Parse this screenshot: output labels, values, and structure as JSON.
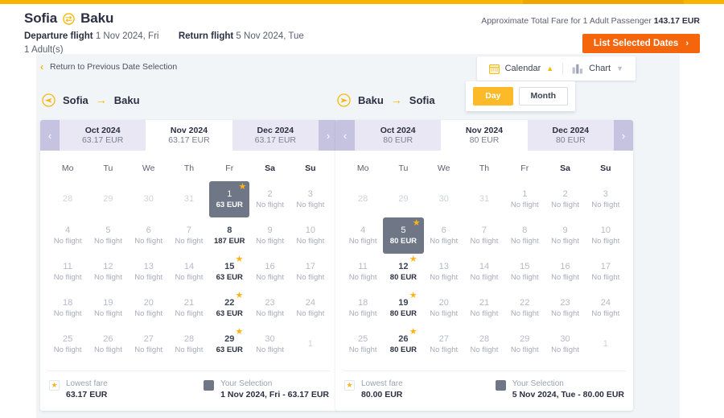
{
  "header": {
    "origin": "Sofia",
    "destination": "Baku",
    "roundtrip_icon": "roundtrip-arrows-icon",
    "departure_label": "Departure flight",
    "departure_value": "1 Nov 2024, Fri",
    "return_label": "Return flight",
    "return_value": "5 Nov 2024, Tue",
    "passengers": "1 Adult(s)",
    "fare_note": "Approximate Total Fare for 1 Adult Passenger",
    "fare_total": "143.17 EUR",
    "list_button": "List Selected Dates",
    "list_button_chevron": "›",
    "accent_yellow": "#f7b500",
    "accent_orange": "#f4650c"
  },
  "toolbar": {
    "return_link": "Return to Previous Date Selection",
    "return_link_icon": "chevron-left-icon",
    "calendar_label": "Calendar",
    "calendar_icon": "calendar-icon",
    "calendar_caret": "▲",
    "chart_label": "Chart",
    "chart_icon": "bar-chart-icon",
    "chart_caret": "▼",
    "day_label": "Day",
    "month_label": "Month",
    "active_granularity": "Day"
  },
  "legs": [
    {
      "id": "outbound",
      "icon": "plane-right-circle-icon",
      "origin": "Sofia",
      "destination": "Baku",
      "arrow": "→",
      "prev_icon": "‹",
      "next_icon": "›",
      "months": [
        {
          "name": "Oct 2024",
          "fare": "63.17 EUR",
          "active": false
        },
        {
          "name": "Nov 2024",
          "fare": "63.17 EUR",
          "active": true
        },
        {
          "name": "Dec 2024",
          "fare": "63.17 EUR",
          "active": false
        }
      ],
      "weekdays": [
        "Mo",
        "Tu",
        "We",
        "Th",
        "Fr",
        "Sa",
        "Su"
      ],
      "weekend_indexes": [
        5,
        6
      ],
      "weeks": [
        [
          {
            "day": "28",
            "sub": "",
            "state": "out"
          },
          {
            "day": "29",
            "sub": "",
            "state": "out"
          },
          {
            "day": "30",
            "sub": "",
            "state": "out"
          },
          {
            "day": "31",
            "sub": "",
            "state": "out"
          },
          {
            "day": "1",
            "sub": "63 EUR",
            "state": "selected",
            "star": true
          },
          {
            "day": "2",
            "sub": "No flight",
            "state": "none"
          },
          {
            "day": "3",
            "sub": "No flight",
            "state": "none"
          }
        ],
        [
          {
            "day": "4",
            "sub": "No flight",
            "state": "none"
          },
          {
            "day": "5",
            "sub": "No flight",
            "state": "none"
          },
          {
            "day": "6",
            "sub": "No flight",
            "state": "none"
          },
          {
            "day": "7",
            "sub": "No flight",
            "state": "none"
          },
          {
            "day": "8",
            "sub": "187 EUR",
            "state": "fare"
          },
          {
            "day": "9",
            "sub": "No flight",
            "state": "none"
          },
          {
            "day": "10",
            "sub": "No flight",
            "state": "none"
          }
        ],
        [
          {
            "day": "11",
            "sub": "No flight",
            "state": "none"
          },
          {
            "day": "12",
            "sub": "No flight",
            "state": "none"
          },
          {
            "day": "13",
            "sub": "No flight",
            "state": "none"
          },
          {
            "day": "14",
            "sub": "No flight",
            "state": "none"
          },
          {
            "day": "15",
            "sub": "63 EUR",
            "state": "fare",
            "star": true
          },
          {
            "day": "16",
            "sub": "No flight",
            "state": "none"
          },
          {
            "day": "17",
            "sub": "No flight",
            "state": "none"
          }
        ],
        [
          {
            "day": "18",
            "sub": "No flight",
            "state": "none"
          },
          {
            "day": "19",
            "sub": "No flight",
            "state": "none"
          },
          {
            "day": "20",
            "sub": "No flight",
            "state": "none"
          },
          {
            "day": "21",
            "sub": "No flight",
            "state": "none"
          },
          {
            "day": "22",
            "sub": "63 EUR",
            "state": "fare",
            "star": true
          },
          {
            "day": "23",
            "sub": "No flight",
            "state": "none"
          },
          {
            "day": "24",
            "sub": "No flight",
            "state": "none"
          }
        ],
        [
          {
            "day": "25",
            "sub": "No flight",
            "state": "none"
          },
          {
            "day": "26",
            "sub": "No flight",
            "state": "none"
          },
          {
            "day": "27",
            "sub": "No flight",
            "state": "none"
          },
          {
            "day": "28",
            "sub": "No flight",
            "state": "none"
          },
          {
            "day": "29",
            "sub": "63 EUR",
            "state": "fare",
            "star": true
          },
          {
            "day": "30",
            "sub": "No flight",
            "state": "none"
          },
          {
            "day": "1",
            "sub": "",
            "state": "out"
          }
        ]
      ],
      "legend": {
        "lowest_label": "Lowest fare",
        "lowest_value": "63.17 EUR",
        "selection_label": "Your Selection",
        "selection_value": "1 Nov 2024, Fri - 63.17 EUR",
        "star_icon": "★"
      }
    },
    {
      "id": "inbound",
      "icon": "plane-left-circle-icon",
      "origin": "Baku",
      "destination": "Sofia",
      "arrow": "→",
      "prev_icon": "‹",
      "next_icon": "›",
      "months": [
        {
          "name": "Oct 2024",
          "fare": "80 EUR",
          "active": false
        },
        {
          "name": "Nov 2024",
          "fare": "80 EUR",
          "active": true
        },
        {
          "name": "Dec 2024",
          "fare": "80 EUR",
          "active": false
        }
      ],
      "weekdays": [
        "Mo",
        "Tu",
        "We",
        "Th",
        "Fr",
        "Sa",
        "Su"
      ],
      "weekend_indexes": [
        5,
        6
      ],
      "weeks": [
        [
          {
            "day": "28",
            "sub": "",
            "state": "out"
          },
          {
            "day": "29",
            "sub": "",
            "state": "out"
          },
          {
            "day": "30",
            "sub": "",
            "state": "out"
          },
          {
            "day": "31",
            "sub": "",
            "state": "out"
          },
          {
            "day": "1",
            "sub": "No flight",
            "state": "none"
          },
          {
            "day": "2",
            "sub": "No flight",
            "state": "none"
          },
          {
            "day": "3",
            "sub": "No flight",
            "state": "none"
          }
        ],
        [
          {
            "day": "4",
            "sub": "No flight",
            "state": "none"
          },
          {
            "day": "5",
            "sub": "80 EUR",
            "state": "selected",
            "star": true
          },
          {
            "day": "6",
            "sub": "No flight",
            "state": "none"
          },
          {
            "day": "7",
            "sub": "No flight",
            "state": "none"
          },
          {
            "day": "8",
            "sub": "No flight",
            "state": "none"
          },
          {
            "day": "9",
            "sub": "No flight",
            "state": "none"
          },
          {
            "day": "10",
            "sub": "No flight",
            "state": "none"
          }
        ],
        [
          {
            "day": "11",
            "sub": "No flight",
            "state": "none"
          },
          {
            "day": "12",
            "sub": "80 EUR",
            "state": "fare",
            "star": true
          },
          {
            "day": "13",
            "sub": "No flight",
            "state": "none"
          },
          {
            "day": "14",
            "sub": "No flight",
            "state": "none"
          },
          {
            "day": "15",
            "sub": "No flight",
            "state": "none"
          },
          {
            "day": "16",
            "sub": "No flight",
            "state": "none"
          },
          {
            "day": "17",
            "sub": "No flight",
            "state": "none"
          }
        ],
        [
          {
            "day": "18",
            "sub": "No flight",
            "state": "none"
          },
          {
            "day": "19",
            "sub": "80 EUR",
            "state": "fare",
            "star": true
          },
          {
            "day": "20",
            "sub": "No flight",
            "state": "none"
          },
          {
            "day": "21",
            "sub": "No flight",
            "state": "none"
          },
          {
            "day": "22",
            "sub": "No flight",
            "state": "none"
          },
          {
            "day": "23",
            "sub": "No flight",
            "state": "none"
          },
          {
            "day": "24",
            "sub": "No flight",
            "state": "none"
          }
        ],
        [
          {
            "day": "25",
            "sub": "No flight",
            "state": "none"
          },
          {
            "day": "26",
            "sub": "80 EUR",
            "state": "fare",
            "star": true
          },
          {
            "day": "27",
            "sub": "No flight",
            "state": "none"
          },
          {
            "day": "28",
            "sub": "No flight",
            "state": "none"
          },
          {
            "day": "29",
            "sub": "No flight",
            "state": "none"
          },
          {
            "day": "30",
            "sub": "No flight",
            "state": "none"
          },
          {
            "day": "1",
            "sub": "",
            "state": "out"
          }
        ]
      ],
      "legend": {
        "lowest_label": "Lowest fare",
        "lowest_value": "80.00 EUR",
        "selection_label": "Your Selection",
        "selection_value": "5 Nov 2024, Tue - 80.00 EUR",
        "star_icon": "★"
      }
    }
  ]
}
